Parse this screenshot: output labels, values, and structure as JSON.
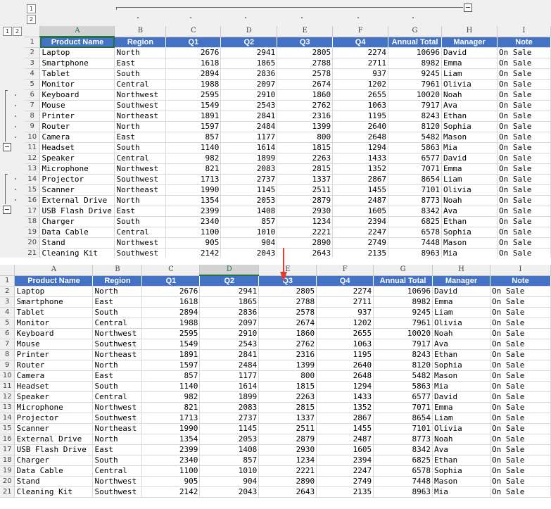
{
  "outline": {
    "col_levels": [
      "1",
      "2"
    ],
    "row_levels": [
      "1",
      "2"
    ]
  },
  "columns": [
    "A",
    "B",
    "C",
    "D",
    "E",
    "F",
    "G",
    "H",
    "I"
  ],
  "row_numbers": [
    "1",
    "2",
    "3",
    "4",
    "5",
    "6",
    "7",
    "8",
    "9",
    "10",
    "11",
    "12",
    "13",
    "14",
    "15",
    "16",
    "17",
    "18",
    "19",
    "20",
    "21"
  ],
  "headers": [
    "Product Name",
    "Region",
    "Q1",
    "Q2",
    "Q3",
    "Q4",
    "Annual Total",
    "Manager",
    "Note"
  ],
  "rows": [
    [
      "Laptop",
      "North",
      "2676",
      "2941",
      "2805",
      "2274",
      "10696",
      "David",
      "On Sale"
    ],
    [
      "Smartphone",
      "East",
      "1618",
      "1865",
      "2788",
      "2711",
      "8982",
      "Emma",
      "On Sale"
    ],
    [
      "Tablet",
      "South",
      "2894",
      "2836",
      "2578",
      "937",
      "9245",
      "Liam",
      "On Sale"
    ],
    [
      "Monitor",
      "Central",
      "1988",
      "2097",
      "2674",
      "1202",
      "7961",
      "Olivia",
      "On Sale"
    ],
    [
      "Keyboard",
      "Northwest",
      "2595",
      "2910",
      "1860",
      "2655",
      "10020",
      "Noah",
      "On Sale"
    ],
    [
      "Mouse",
      "Southwest",
      "1549",
      "2543",
      "2762",
      "1063",
      "7917",
      "Ava",
      "On Sale"
    ],
    [
      "Printer",
      "Northeast",
      "1891",
      "2841",
      "2316",
      "1195",
      "8243",
      "Ethan",
      "On Sale"
    ],
    [
      "Router",
      "North",
      "1597",
      "2484",
      "1399",
      "2640",
      "8120",
      "Sophia",
      "On Sale"
    ],
    [
      "Camera",
      "East",
      "857",
      "1177",
      "800",
      "2648",
      "5482",
      "Mason",
      "On Sale"
    ],
    [
      "Headset",
      "South",
      "1140",
      "1614",
      "1815",
      "1294",
      "5863",
      "Mia",
      "On Sale"
    ],
    [
      "Speaker",
      "Central",
      "982",
      "1899",
      "2263",
      "1433",
      "6577",
      "David",
      "On Sale"
    ],
    [
      "Microphone",
      "Northwest",
      "821",
      "2083",
      "2815",
      "1352",
      "7071",
      "Emma",
      "On Sale"
    ],
    [
      "Projector",
      "Southwest",
      "1713",
      "2737",
      "1337",
      "2867",
      "8654",
      "Liam",
      "On Sale"
    ],
    [
      "Scanner",
      "Northeast",
      "1990",
      "1145",
      "2511",
      "1455",
      "7101",
      "Olivia",
      "On Sale"
    ],
    [
      "External Drive",
      "North",
      "1354",
      "2053",
      "2879",
      "2487",
      "8773",
      "Noah",
      "On Sale"
    ],
    [
      "USB Flash Drive",
      "East",
      "2399",
      "1408",
      "2930",
      "1605",
      "8342",
      "Ava",
      "On Sale"
    ],
    [
      "Charger",
      "South",
      "2340",
      "857",
      "1234",
      "2394",
      "6825",
      "Ethan",
      "On Sale"
    ],
    [
      "Data Cable",
      "Central",
      "1100",
      "1010",
      "2221",
      "2247",
      "6578",
      "Sophia",
      "On Sale"
    ],
    [
      "Stand",
      "Northwest",
      "905",
      "904",
      "2890",
      "2749",
      "7448",
      "Mason",
      "On Sale"
    ],
    [
      "Cleaning Kit",
      "Southwest",
      "2142",
      "2043",
      "2643",
      "2135",
      "8963",
      "Mia",
      "On Sale"
    ]
  ],
  "colors": {
    "header_bg": "#4472c4",
    "header_text": "#ffffff",
    "selection": "#217346",
    "arrow": "#e03c31"
  },
  "icons": {
    "collapse": "minus-icon",
    "arrow": "down-arrow-icon"
  }
}
